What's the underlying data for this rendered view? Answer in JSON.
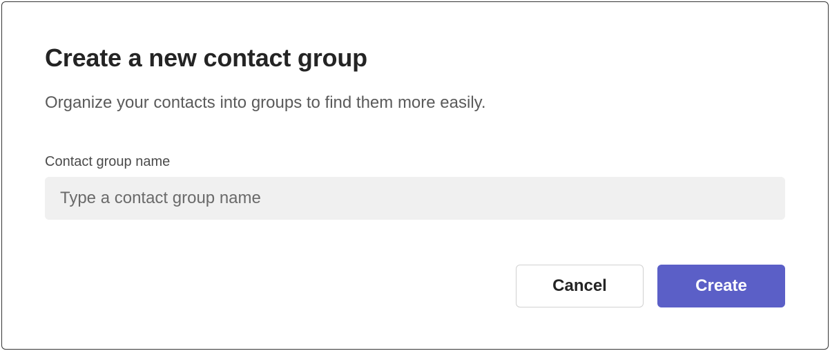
{
  "dialog": {
    "title": "Create a new contact group",
    "description": "Organize your contacts into groups to find them more easily.",
    "field": {
      "label": "Contact group name",
      "placeholder": "Type a contact group name",
      "value": ""
    },
    "buttons": {
      "cancel": "Cancel",
      "create": "Create"
    }
  }
}
